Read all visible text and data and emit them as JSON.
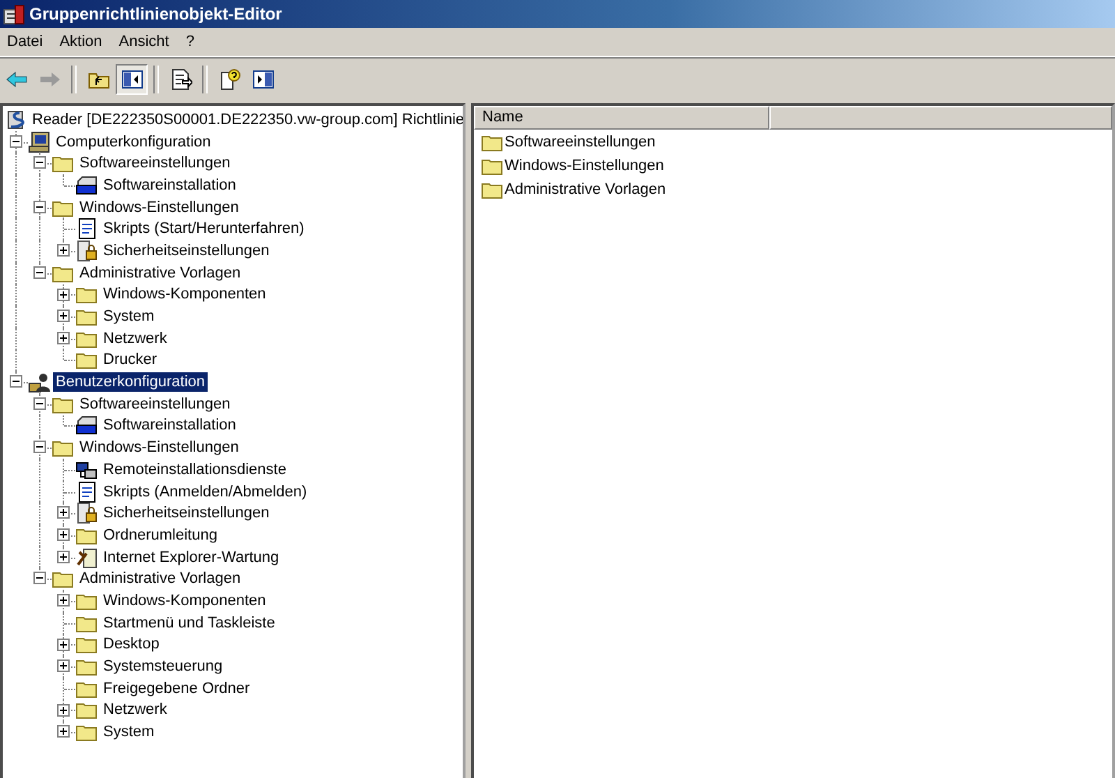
{
  "window": {
    "title": "Gruppenrichtlinienobjekt-Editor"
  },
  "menu": [
    "Datei",
    "Aktion",
    "Ansicht",
    "?"
  ],
  "toolbar": [
    {
      "kind": "back",
      "disabled": false
    },
    {
      "kind": "forward",
      "disabled": true
    },
    {
      "kind": "sep"
    },
    {
      "kind": "up"
    },
    {
      "kind": "tree",
      "pressed": true
    },
    {
      "kind": "sep"
    },
    {
      "kind": "export"
    },
    {
      "kind": "sep"
    },
    {
      "kind": "help"
    },
    {
      "kind": "panel",
      "pressed": false
    }
  ],
  "tree": {
    "root": {
      "label": "Reader [DE222350S00001.DE222350.vw-group.com] Richtlinie",
      "kind": "policy",
      "selected": false
    },
    "children": [
      {
        "label": "Computerkonfiguration",
        "kind": "computer",
        "expanded": true,
        "selected": false,
        "children": [
          {
            "label": "Softwareeinstellungen",
            "kind": "folder",
            "expanded": true,
            "selected": false,
            "children": [
              {
                "label": "Softwareinstallation",
                "kind": "software",
                "selected": false
              }
            ]
          },
          {
            "label": "Windows-Einstellungen",
            "kind": "folder",
            "expanded": true,
            "selected": false,
            "children": [
              {
                "label": "Skripts (Start/Herunterfahren)",
                "kind": "script",
                "selected": false
              },
              {
                "label": "Sicherheitseinstellungen",
                "kind": "security",
                "expanded": false,
                "selected": false
              }
            ]
          },
          {
            "label": "Administrative Vorlagen",
            "kind": "folder",
            "expanded": true,
            "selected": false,
            "children": [
              {
                "label": "Windows-Komponenten",
                "kind": "folder",
                "expanded": false,
                "selected": false
              },
              {
                "label": "System",
                "kind": "folder",
                "expanded": false,
                "selected": false
              },
              {
                "label": "Netzwerk",
                "kind": "folder",
                "expanded": false,
                "selected": false
              },
              {
                "label": "Drucker",
                "kind": "folder",
                "selected": false
              }
            ]
          }
        ]
      },
      {
        "label": "Benutzerkonfiguration",
        "kind": "user",
        "expanded": true,
        "selected": true,
        "children": [
          {
            "label": "Softwareeinstellungen",
            "kind": "folder",
            "expanded": true,
            "selected": false,
            "children": [
              {
                "label": "Softwareinstallation",
                "kind": "software",
                "selected": false
              }
            ]
          },
          {
            "label": "Windows-Einstellungen",
            "kind": "folder",
            "expanded": true,
            "selected": false,
            "children": [
              {
                "label": "Remoteinstallationsdienste",
                "kind": "remote",
                "selected": false
              },
              {
                "label": "Skripts (Anmelden/Abmelden)",
                "kind": "script",
                "selected": false
              },
              {
                "label": "Sicherheitseinstellungen",
                "kind": "security",
                "expanded": false,
                "selected": false
              },
              {
                "label": "Ordnerumleitung",
                "kind": "folder",
                "expanded": false,
                "selected": false
              },
              {
                "label": "Internet Explorer-Wartung",
                "kind": "ie",
                "expanded": false,
                "selected": false
              }
            ]
          },
          {
            "label": "Administrative Vorlagen",
            "kind": "folder",
            "expanded": true,
            "selected": false,
            "children": [
              {
                "label": "Windows-Komponenten",
                "kind": "folder",
                "expanded": false,
                "selected": false
              },
              {
                "label": "Startmenü und Taskleiste",
                "kind": "folder",
                "selected": false
              },
              {
                "label": "Desktop",
                "kind": "folder",
                "expanded": false,
                "selected": false
              },
              {
                "label": "Systemsteuerung",
                "kind": "folder",
                "expanded": false,
                "selected": false
              },
              {
                "label": "Freigegebene Ordner",
                "kind": "folder",
                "selected": false
              },
              {
                "label": "Netzwerk",
                "kind": "folder",
                "expanded": false,
                "selected": false
              },
              {
                "label": "System",
                "kind": "folder",
                "expanded": false,
                "selected": false
              }
            ]
          }
        ]
      }
    ]
  },
  "list": {
    "columns": [
      "Name"
    ],
    "rows": [
      {
        "name": "Softwareeinstellungen",
        "kind": "folder"
      },
      {
        "name": "Windows-Einstellungen",
        "kind": "folder"
      },
      {
        "name": "Administrative Vorlagen",
        "kind": "folder"
      }
    ]
  }
}
